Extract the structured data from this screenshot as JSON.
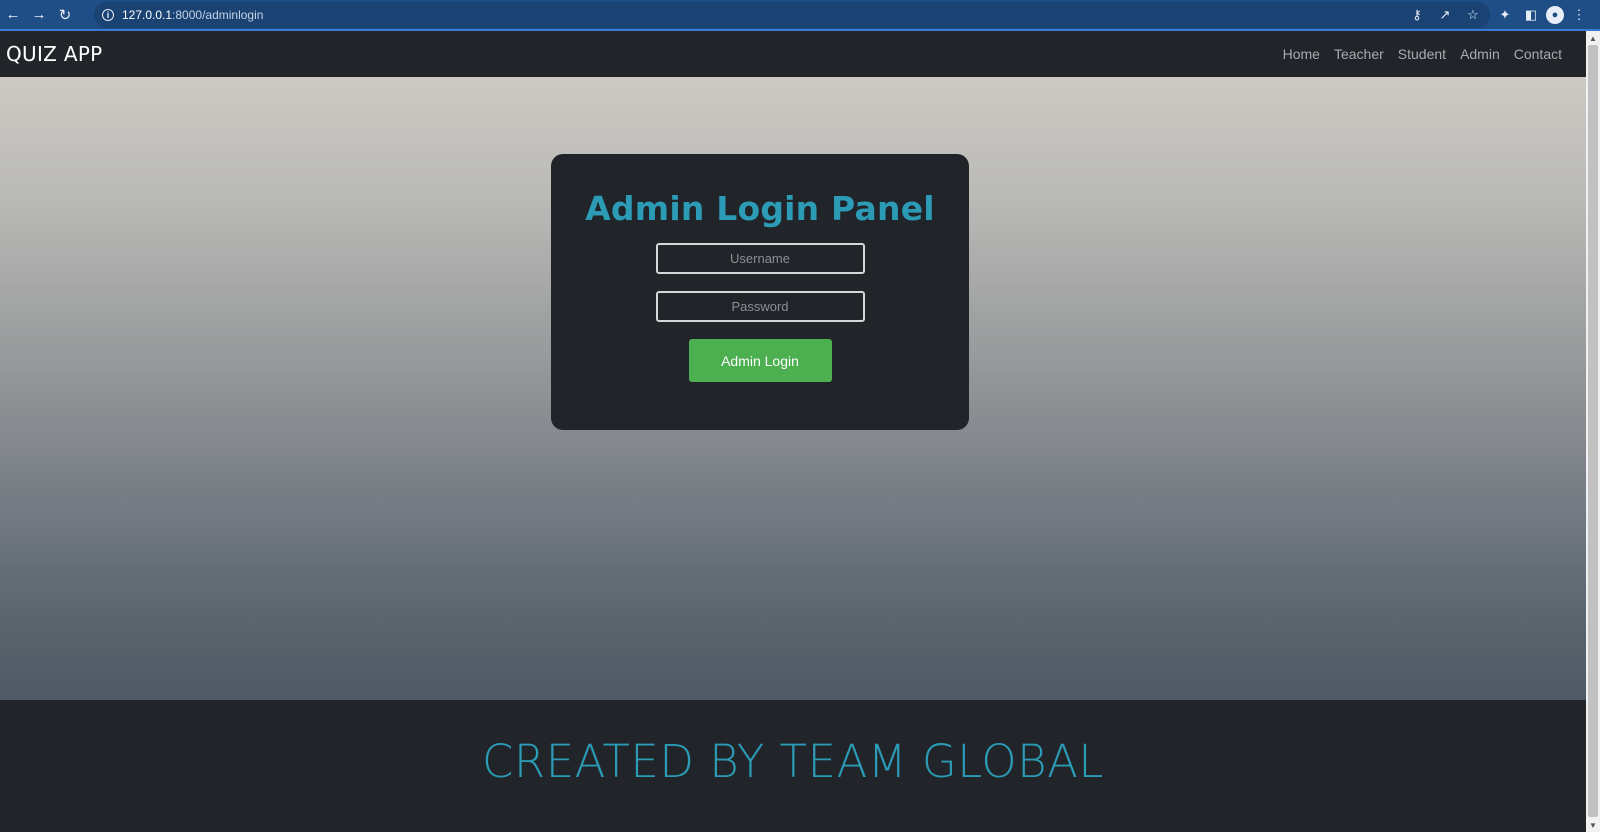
{
  "browser": {
    "url_host": "127.0.0.1",
    "url_path": ":8000/adminlogin"
  },
  "navbar": {
    "brand": "QUIZ APP",
    "links": [
      "Home",
      "Teacher",
      "Student",
      "Admin",
      "Contact"
    ]
  },
  "login": {
    "title": "Admin Login Panel",
    "username_placeholder": "Username",
    "password_placeholder": "Password",
    "button_label": "Admin Login"
  },
  "footer": {
    "text": "CREATED BY TEAM GLOBAL"
  },
  "colors": {
    "accent": "#2b9bb6",
    "button": "#4caf50",
    "dark": "#212529"
  }
}
